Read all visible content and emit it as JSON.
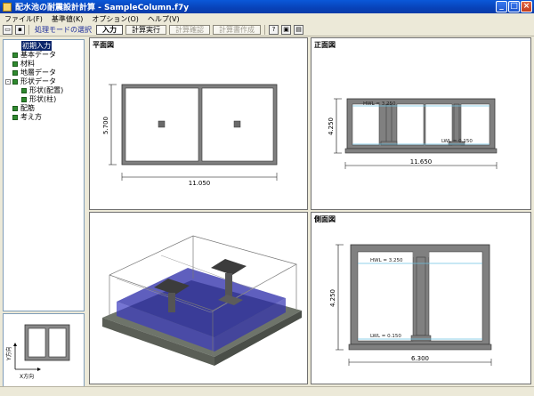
{
  "window": {
    "title": "配水池の耐震設計計算 - SampleColumn.f7y"
  },
  "menu": [
    "ファイル(F)",
    "基準値(K)",
    "オプション(O)",
    "ヘルプ(V)"
  ],
  "toolbar": {
    "mode_label": "処理モードの選択",
    "input": "入力",
    "calc_run": "計算実行",
    "calc_check": "計算確認",
    "report": "計算書作成"
  },
  "tree": {
    "items": [
      {
        "label": "初期入力",
        "level": 0,
        "selected": true
      },
      {
        "label": "基本データ",
        "level": 1
      },
      {
        "label": "材料",
        "level": 1
      },
      {
        "label": "地層データ",
        "level": 1
      },
      {
        "label": "形状データ",
        "level": 1,
        "expandable": true
      },
      {
        "label": "形状(配置)",
        "level": 2
      },
      {
        "label": "形状(柱)",
        "level": 2
      },
      {
        "label": "配筋",
        "level": 1
      },
      {
        "label": "考え方",
        "level": 1
      }
    ]
  },
  "thumbnail": {
    "y_label": "Y方向",
    "x_label": "X方向"
  },
  "plan": {
    "title": "平面図",
    "width_dim": "11.050",
    "height_dim": "5.700"
  },
  "front": {
    "title": "正面図",
    "width_dim": "11.650",
    "height_dim": "4.250",
    "hwl": "HWL = 3.250",
    "lwl": "LWL = 0.150"
  },
  "side": {
    "title": "側面図",
    "width_dim": "6.300",
    "height_dim": "4.250",
    "hwl": "HWL = 3.250",
    "lwl": "LWL = 0.150"
  },
  "view3d": {
    "title": ""
  }
}
